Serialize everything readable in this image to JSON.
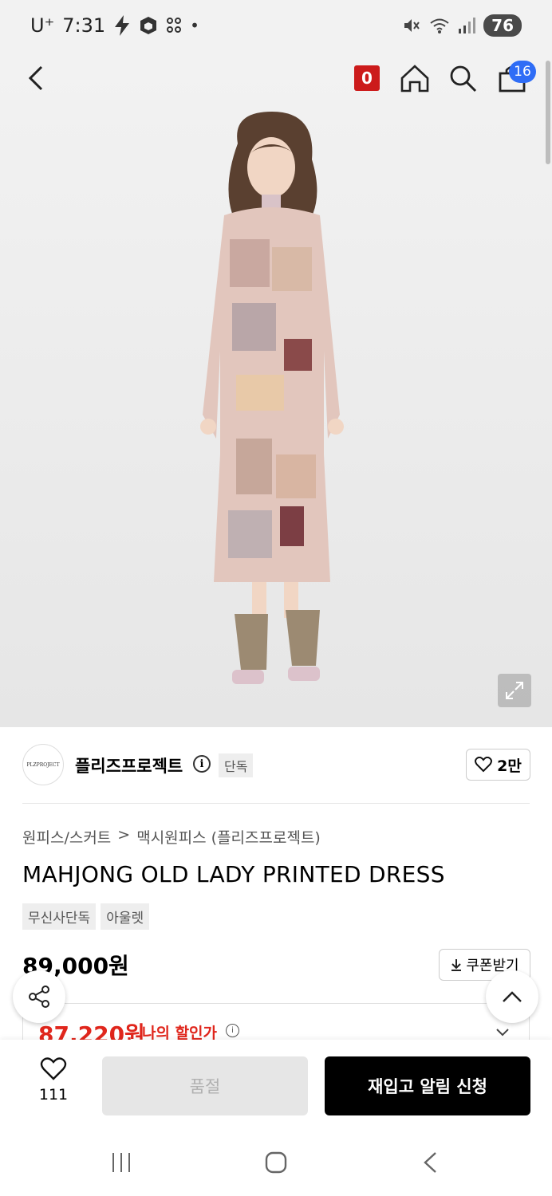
{
  "status_bar": {
    "carrier": "U⁺",
    "time": "7:31",
    "battery": "76"
  },
  "header": {
    "notification_count": "0",
    "cart_count": "16"
  },
  "brand": {
    "logo_text": "PLZPROJECT",
    "name": "플리즈프로젝트",
    "exclusive_tag": "단독",
    "like_count": "2만"
  },
  "breadcrumb": {
    "category": "원피스/스커트",
    "separator": ">",
    "subcategory": "맥시원피스 (플리즈프로젝트)"
  },
  "product": {
    "title": "MAHJONG OLD LADY PRINTED DRESS",
    "tags": [
      "무신사단독",
      "아울렛"
    ],
    "price": "89,000원",
    "coupon_label": "쿠폰받기",
    "my_price": "87,220원",
    "my_price_label": "나의 할인가"
  },
  "bottom_bar": {
    "wish_count": "111",
    "soldout_label": "품절",
    "restock_label": "재입고 알림 신청"
  },
  "colors": {
    "accent_red": "#e0261c",
    "badge_red": "#cc1b1b",
    "cart_blue": "#2f6df6"
  }
}
